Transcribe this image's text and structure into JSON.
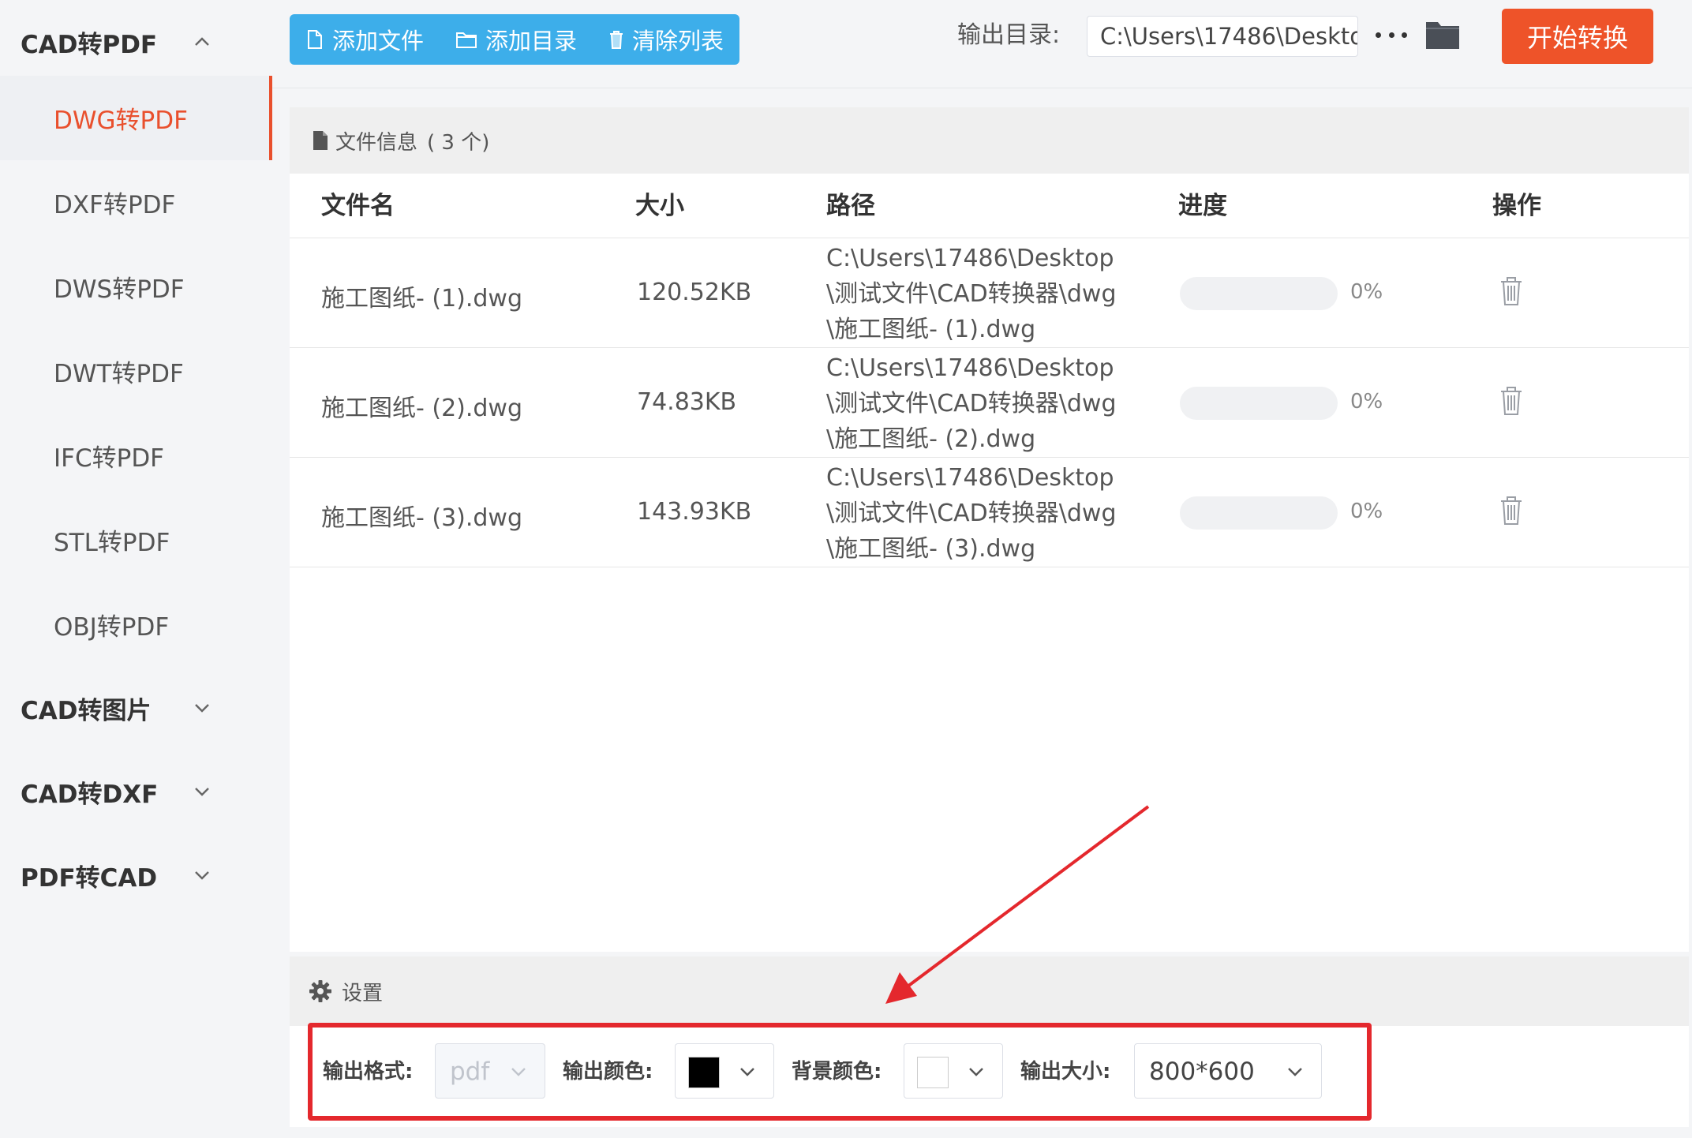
{
  "sidebar": {
    "groups": [
      {
        "label": "CAD转PDF",
        "expanded": true,
        "items": [
          "DWG转PDF",
          "DXF转PDF",
          "DWS转PDF",
          "DWT转PDF",
          "IFC转PDF",
          "STL转PDF",
          "OBJ转PDF"
        ],
        "active_item": "DWG转PDF"
      },
      {
        "label": "CAD转图片",
        "expanded": false
      },
      {
        "label": "CAD转DXF",
        "expanded": false
      },
      {
        "label": "PDF转CAD",
        "expanded": false
      }
    ]
  },
  "toolbar": {
    "add_file": "添加文件",
    "add_dir": "添加目录",
    "clear_list": "清除列表",
    "output_dir_label": "输出目录:",
    "output_dir_value": "C:\\Users\\17486\\Deskto",
    "more_icon": "ellipsis-icon",
    "folder_icon": "folder-icon",
    "start": "开始转换"
  },
  "file_panel": {
    "title": "文件信息",
    "count_text": "( 3 个)",
    "columns": [
      "文件名",
      "大小",
      "路径",
      "进度",
      "操作"
    ],
    "rows": [
      {
        "name": "施工图纸- (1).dwg",
        "size": "120.52KB",
        "path": [
          "C:\\Users\\17486\\Desktop",
          "\\测试文件\\CAD转换器\\dwg",
          "\\施工图纸- (1).dwg"
        ],
        "progress": 0,
        "progress_text": "0%"
      },
      {
        "name": "施工图纸- (2).dwg",
        "size": "74.83KB",
        "path": [
          "C:\\Users\\17486\\Desktop",
          "\\测试文件\\CAD转换器\\dwg",
          "\\施工图纸- (2).dwg"
        ],
        "progress": 0,
        "progress_text": "0%"
      },
      {
        "name": "施工图纸- (3).dwg",
        "size": "143.93KB",
        "path": [
          "C:\\Users\\17486\\Desktop",
          "\\测试文件\\CAD转换器\\dwg",
          "\\施工图纸- (3).dwg"
        ],
        "progress": 0,
        "progress_text": "0%"
      }
    ]
  },
  "settings": {
    "title": "设置",
    "output_format_label": "输出格式:",
    "output_format_value": "pdf",
    "output_color_label": "输出颜色:",
    "output_color_value": "#000000",
    "bg_color_label": "背景颜色:",
    "bg_color_value": "#ffffff",
    "output_size_label": "输出大小:",
    "output_size_value": "800*600"
  },
  "colors": {
    "accent_blue": "#3daeea",
    "accent_orange": "#ee5329",
    "active_red": "#e9502d",
    "annotation_red": "#e4282d"
  }
}
